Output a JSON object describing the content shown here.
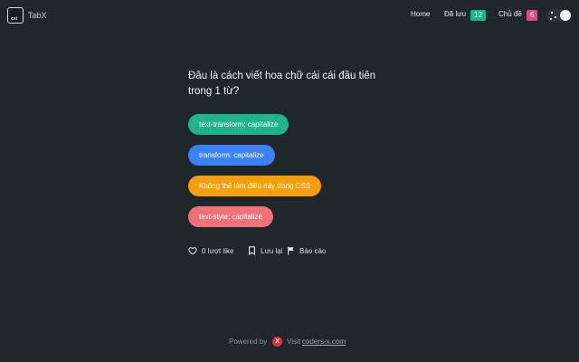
{
  "header": {
    "logo_glyph": "cst",
    "brand": "TabX",
    "nav": {
      "home": "Home",
      "saved": "Đã lưu",
      "saved_count": "12",
      "topics": "Chủ đề",
      "topics_count": "6"
    }
  },
  "quiz": {
    "question": "Đâu là cách viết hoa chữ cái cái đầu tiên trong 1 từ?",
    "answers": [
      {
        "label": "text-transform: capitalize",
        "color": "#20b486"
      },
      {
        "label": "transform: capitalize",
        "color": "#3b82f6"
      },
      {
        "label": "Không thể làm điều này trong CSS",
        "color": "#f59f0b"
      },
      {
        "label": "text-style: capitalize",
        "color": "#f07178"
      }
    ],
    "actions": {
      "like": "0 lượt like",
      "save": "Lưu lại",
      "report": "Báo cáo"
    }
  },
  "footer": {
    "powered": "Powered by",
    "x_mark": "X",
    "visit": "Visit",
    "link": "coders-x.com"
  },
  "colors": {
    "background": "#1f272b",
    "badge_saved": "#12b886",
    "badge_topics": "#e64980"
  }
}
